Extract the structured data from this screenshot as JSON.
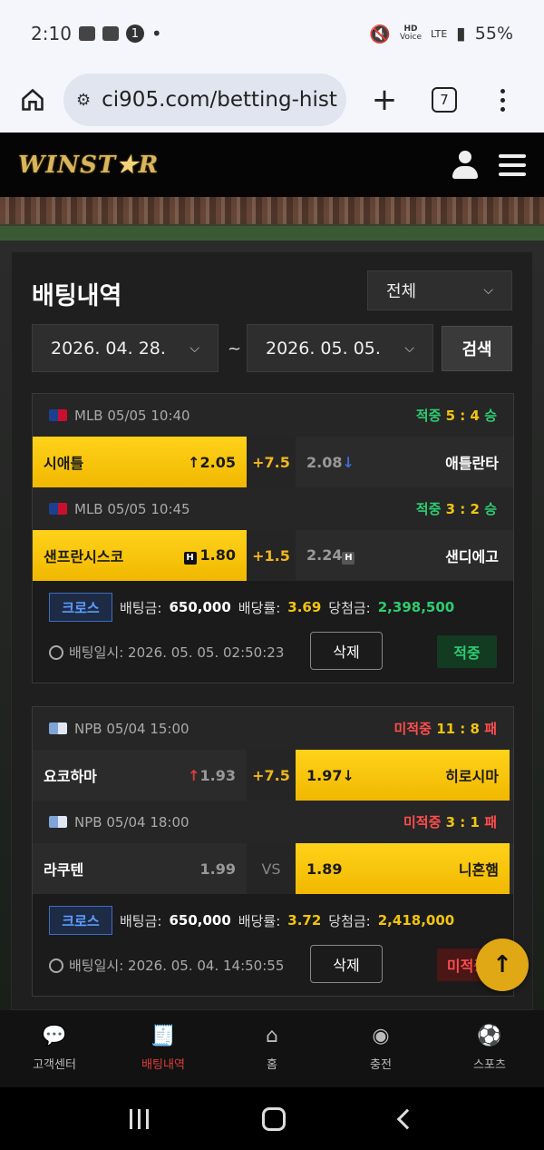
{
  "status_bar": {
    "time": "2:10",
    "notif_count": "1",
    "dot": "•",
    "battery": "55%",
    "hd_label": "HD",
    "voice_label": "Voice",
    "lte_label": "LTE"
  },
  "browser": {
    "url": "ci905.com/betting-hist",
    "tab_count": "7"
  },
  "site": {
    "logo_text_a": "WINST",
    "logo_star": "★",
    "logo_text_b": "R"
  },
  "panel": {
    "title": "배팅내역",
    "filter_value": "전체",
    "date_from": "2026. 04. 28.",
    "date_to": "2026. 05. 05.",
    "tilde": "~",
    "search_label": "검색"
  },
  "bets": [
    {
      "games": [
        {
          "league": "MLB",
          "datetime": "05/05 10:40",
          "result_label": "적중",
          "score": "5 : 4",
          "outcome": "승",
          "home": "시애틀",
          "home_odds": "2.05",
          "home_arrow": "↑",
          "handicap": "+7.5",
          "away_odds": "2.08",
          "away_arrow": "↓",
          "away": "애틀란타"
        },
        {
          "league": "MLB",
          "datetime": "05/05 10:45",
          "result_label": "적중",
          "score": "3 : 2",
          "outcome": "승",
          "home": "샌프란시스코",
          "home_odds": "1.80",
          "home_badge": "H",
          "handicap": "+1.5",
          "away_odds": "2.24",
          "away_badge": "H",
          "away": "샌디에고"
        }
      ],
      "type_label": "크로스",
      "stake_label": "배팅금:",
      "stake": "650,000",
      "rate_label": "배당률:",
      "rate": "3.69",
      "payout_label": "당첨금:",
      "payout": "2,398,500",
      "time_label": "배팅일시:",
      "time": "2026. 05. 05. 02:50:23",
      "delete_label": "삭제",
      "status": "적중"
    },
    {
      "games": [
        {
          "league": "NPB",
          "datetime": "05/04 15:00",
          "result_label": "미적중",
          "score": "11 : 8",
          "outcome": "패",
          "home": "요코하마",
          "home_odds": "1.93",
          "home_arrow": "↑",
          "handicap": "+7.5",
          "away_odds": "1.97",
          "away_arrow": "↓",
          "away": "히로시마"
        },
        {
          "league": "NPB",
          "datetime": "05/04 18:00",
          "result_label": "미적중",
          "score": "3 : 1",
          "outcome": "패",
          "home": "라쿠텐",
          "home_odds": "1.99",
          "handicap": "VS",
          "away_odds": "1.89",
          "away": "니혼햄"
        }
      ],
      "type_label": "크로스",
      "stake_label": "배팅금:",
      "stake": "650,000",
      "rate_label": "배당률:",
      "rate": "3.72",
      "payout_label": "당첨금:",
      "payout": "2,418,000",
      "time_label": "배팅일시:",
      "time": "2026. 05. 04. 14:50:55",
      "delete_label": "삭제",
      "status": "미적중"
    }
  ],
  "bottom_nav": [
    {
      "label": "고객센터",
      "icon": "chat-icon"
    },
    {
      "label": "배팅내역",
      "icon": "receipt-icon"
    },
    {
      "label": "홈",
      "icon": "home-icon"
    },
    {
      "label": "충전",
      "icon": "coins-icon"
    },
    {
      "label": "스포츠",
      "icon": "soccer-ball-icon"
    }
  ],
  "scroll_top": "↑"
}
